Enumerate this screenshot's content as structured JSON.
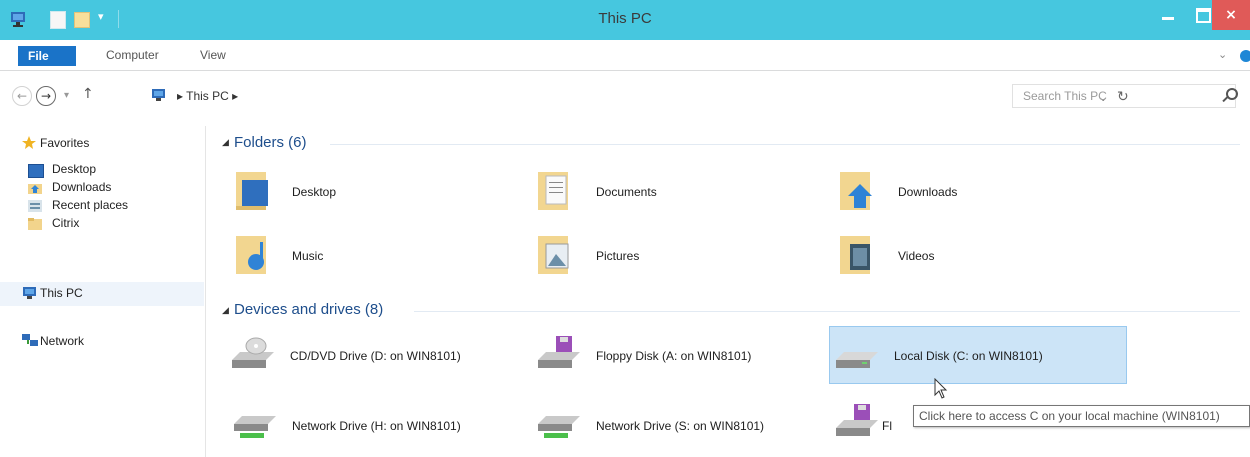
{
  "window": {
    "title": "This PC",
    "close_glyph": "×",
    "quick_access_dropdown": "▾"
  },
  "ribbon": {
    "tabs": [
      {
        "label": "File"
      },
      {
        "label": "Computer"
      },
      {
        "label": "View"
      }
    ],
    "expand_glyph": "⌄"
  },
  "address_bar": {
    "back_glyph": "←",
    "forward_glyph": "→",
    "recent_glyph": "▾",
    "up_glyph": "↑",
    "breadcrumb": "▸ This PC ▸",
    "dropdown_glyph": "⌄",
    "refresh_glyph": "↻"
  },
  "search": {
    "placeholder": "Search This PC"
  },
  "nav_pane": {
    "favorites": "Favorites",
    "desktop": "Desktop",
    "downloads": "Downloads",
    "recent_places": "Recent places",
    "citrix": "Citrix",
    "this_pc": "This PC",
    "network": "Network"
  },
  "folders_group": {
    "title": "Folders (6)",
    "expand_glyph": "◢",
    "items": [
      {
        "label": "Desktop",
        "icon": "desktop-folder-icon"
      },
      {
        "label": "Documents",
        "icon": "documents-folder-icon"
      },
      {
        "label": "Downloads",
        "icon": "downloads-folder-icon"
      },
      {
        "label": "Music",
        "icon": "music-folder-icon"
      },
      {
        "label": "Pictures",
        "icon": "pictures-folder-icon"
      },
      {
        "label": "Videos",
        "icon": "videos-folder-icon"
      }
    ]
  },
  "devices_group": {
    "title": "Devices and drives (8)",
    "expand_glyph": "◢",
    "items": [
      {
        "label": "CD/DVD Drive (D: on WIN8101)",
        "icon": "cd-drive-icon"
      },
      {
        "label": "Floppy Disk (A: on WIN8101)",
        "icon": "floppy-drive-icon"
      },
      {
        "label": "Local Disk (C: on WIN8101)",
        "icon": "local-disk-icon"
      },
      {
        "label": "Network Drive (H: on WIN8101)",
        "icon": "network-drive-icon"
      },
      {
        "label": "Network Drive (S: on WIN8101)",
        "icon": "network-drive-icon"
      },
      {
        "label": "Fl",
        "icon": "floppy-drive-icon"
      }
    ]
  },
  "tooltip": {
    "text": "Click here to access C on your local machine (WIN8101)"
  },
  "colors": {
    "titlebar": "#46c7df",
    "file_tab": "#1a73c8",
    "close_button": "#e05a58",
    "selection": "#cce4f7",
    "group_header": "#1e4e8c"
  }
}
